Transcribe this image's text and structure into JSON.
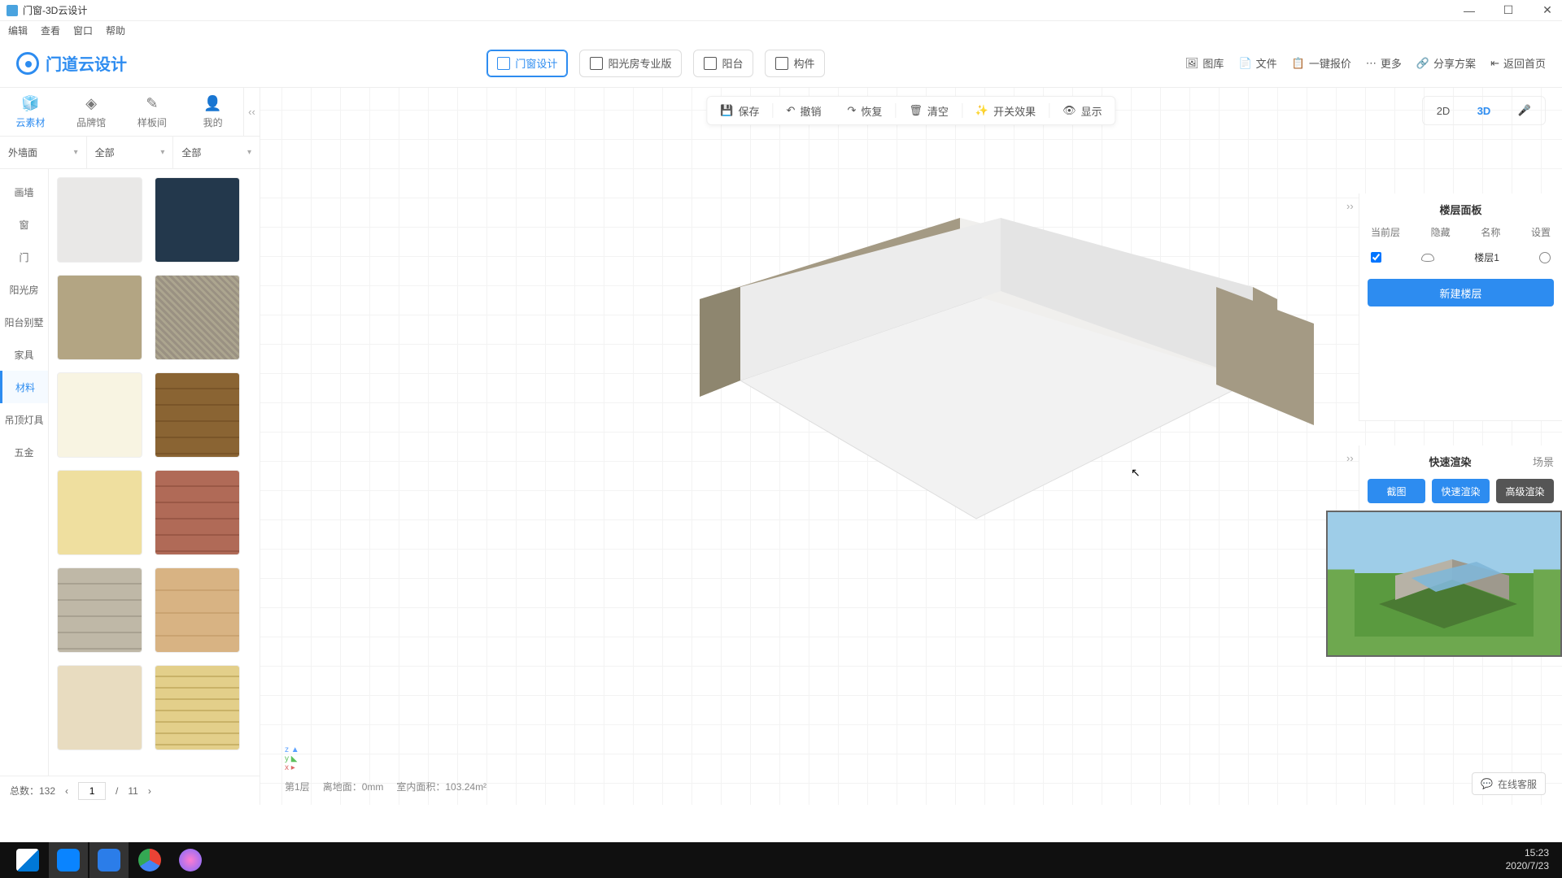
{
  "window": {
    "title": "门窗-3D云设计"
  },
  "window_controls": {
    "min": "—",
    "max": "☐",
    "close": "✕"
  },
  "menu": [
    "编辑",
    "查看",
    "窗口",
    "帮助"
  ],
  "logo_text": "门道云设计",
  "top_center": [
    {
      "label": "门窗设计",
      "active": true
    },
    {
      "label": "阳光房专业版",
      "active": false
    },
    {
      "label": "阳台",
      "active": false
    },
    {
      "label": "构件",
      "active": false
    }
  ],
  "top_right": [
    {
      "icon": "image-icon",
      "label": "图库"
    },
    {
      "icon": "file-icon",
      "label": "文件"
    },
    {
      "icon": "quote-icon",
      "label": "一键报价"
    },
    {
      "icon": "more-icon",
      "label": "更多"
    },
    {
      "icon": "share-icon",
      "label": "分享方案"
    },
    {
      "icon": "home-icon",
      "label": "返回首页"
    }
  ],
  "left_tabs": [
    {
      "icon": "🧊",
      "label": "云素材",
      "active": true
    },
    {
      "icon": "◈",
      "label": "品牌馆"
    },
    {
      "icon": "✎",
      "label": "样板间"
    },
    {
      "icon": "👤",
      "label": "我的"
    }
  ],
  "filters": [
    {
      "label": "外墙面"
    },
    {
      "label": "全部"
    },
    {
      "label": "全部"
    }
  ],
  "categories": [
    "画墙",
    "窗",
    "门",
    "阳光房",
    "阳台别墅",
    "家具",
    "材料",
    "吊顶灯具",
    "五金"
  ],
  "categories_active": "材料",
  "materials": [
    {
      "bg": "#e9e8e7"
    },
    {
      "bg": "#23384c"
    },
    {
      "bg": "#b3a583"
    },
    {
      "bg": "repeating-linear-gradient(45deg,#9a9182,#9a9182 3px,#aca58f 3px,#aca58f 6px)"
    },
    {
      "bg": "#f8f4e2"
    },
    {
      "bg": "repeating-linear-gradient(#8a6433 0 18px,#7a5529 18px 20px),repeating-linear-gradient(90deg,#8a6433 0 34px,#7a5529 34px 36px)"
    },
    {
      "bg": "#efdf9f"
    },
    {
      "bg": "repeating-linear-gradient(#b06a57 0 18px,#9a5846 18px 20px),repeating-linear-gradient(90deg,#b06a57 0 34px,#9a5846 34px 36px)"
    },
    {
      "bg": "repeating-linear-gradient(#bfb8a7 0 18px,#a8a191 18px 20px),repeating-linear-gradient(90deg,#bfb8a7 0 34px,#a8a191 34px 36px)"
    },
    {
      "bg": "repeating-linear-gradient(#d8b383 0 26px,#caa371 26px 28px)"
    },
    {
      "bg": "#e8dcc0"
    },
    {
      "bg": "repeating-linear-gradient(#e3cf8a 0 12px,#c9b268 12px 14px),repeating-linear-gradient(90deg,#e3cf8a 0 20px,#c9b268 20px 22px)"
    }
  ],
  "paging": {
    "total_label": "总数：132",
    "page": "1",
    "pages": "11"
  },
  "canvas_toolbar": [
    {
      "icon": "💾",
      "label": "保存"
    },
    {
      "icon": "↶",
      "label": "撤销"
    },
    {
      "icon": "↷",
      "label": "恢复"
    },
    {
      "icon": "🗑",
      "label": "清空"
    },
    {
      "icon": "✨",
      "label": "开关效果"
    },
    {
      "icon": "👁",
      "label": "显示"
    }
  ],
  "view_mode": {
    "d2": "2D",
    "d3": "3D",
    "active": "3D"
  },
  "status": {
    "floor": "第1层",
    "ground": "离地面：0mm",
    "area": "室内面积：103.24m²"
  },
  "floor_panel": {
    "title": "楼层面板",
    "cols": [
      "当前层",
      "隐藏",
      "名称",
      "设置"
    ],
    "row_name": "楼层1",
    "new_btn": "新建楼层"
  },
  "render_panel": {
    "title": "快速渲染",
    "scene": "场景",
    "btns": [
      "截图",
      "快速渲染",
      "高级渲染"
    ]
  },
  "online_cs": "在线客服",
  "clock": {
    "time": "15:23",
    "date": "2020/7/23"
  }
}
